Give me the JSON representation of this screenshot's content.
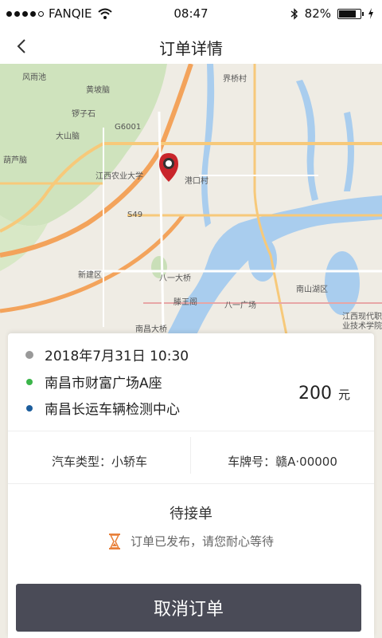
{
  "status_bar": {
    "carrier": "FANQIE",
    "time": "08:47",
    "battery": "82%",
    "battery_level": 0.82,
    "signal_bars": 4,
    "icons": [
      "signal-dots-icon",
      "wifi-icon",
      "bluetooth-icon",
      "battery-icon",
      "charging-icon"
    ]
  },
  "nav": {
    "title": "订单详情",
    "back_icon": "chevron-left-icon"
  },
  "map": {
    "labels": [
      "风雨池",
      "黄坡脑",
      "锣子石",
      "大山脑",
      "葫芦脑",
      "江西农业大学",
      "八一大桥",
      "滕王阁",
      "八一广场",
      "南昌大桥",
      "港口村",
      "江西现代职业技术学院",
      "南山湖区",
      "新建区",
      "界桥村",
      "G6001",
      "S49"
    ]
  },
  "order": {
    "datetime": "2018年7月31日 10:30",
    "origin": "南昌市财富广场A座",
    "destination": "南昌长运车辆检测中心",
    "price": "200",
    "price_unit": "元",
    "car_type_label": "汽车类型：小轿车",
    "plate_label": "车牌号：赣A·00000",
    "status": "待接单",
    "status_note": "订单已发布，请您耐心等待",
    "cancel_label": "取消订单"
  },
  "colors": {
    "accent_green": "#3bb54a",
    "accent_blue": "#1c5d9c",
    "button_bg": "#4a4b57",
    "pin_red": "#c9252b",
    "hourglass": "#e8803a"
  }
}
